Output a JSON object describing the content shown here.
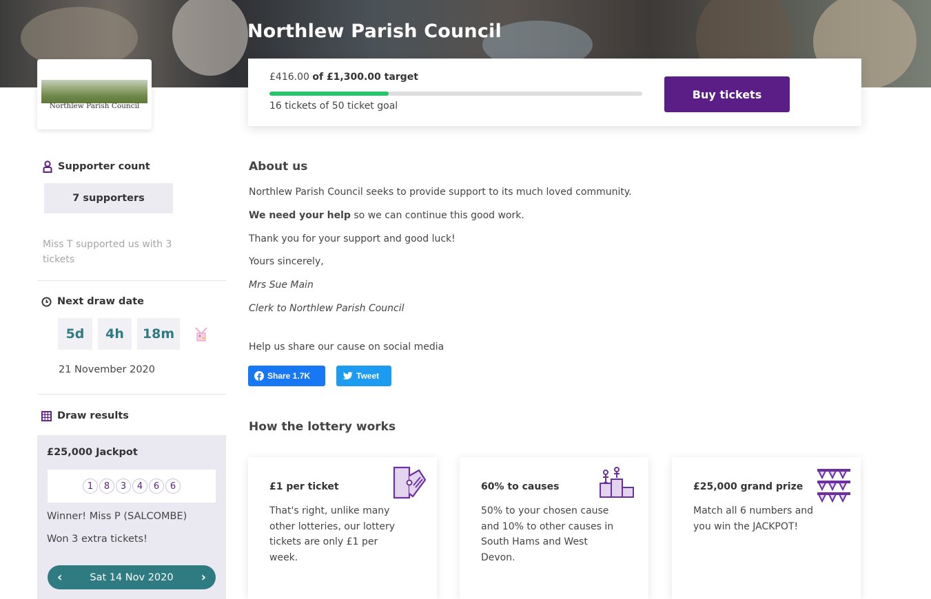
{
  "header": {
    "title": "Northlew Parish Council"
  },
  "logo": {
    "text": "Northlew Parish Council"
  },
  "progress": {
    "raised": "£416.00",
    "target_text": "of £1,300.00 target",
    "fraction_raised": 0.32,
    "tickets_text": "16 tickets of 50 ticket goal",
    "buy_label": "Buy tickets",
    "bar_color": "#22c76a",
    "button_color": "#5b1e86"
  },
  "sidebar": {
    "supporter_count_title": "Supporter count",
    "supporters": "7 supporters",
    "latest_support": "Miss T supported us with 3 tickets",
    "next_draw_title": "Next draw date",
    "countdown": {
      "days": "5d",
      "hours": "4h",
      "minutes": "18m"
    },
    "draw_date": "21 November 2020",
    "draw_results_title": "Draw results",
    "jackpot": "£25,000 Jackpot",
    "numbers": [
      "1",
      "8",
      "3",
      "4",
      "6",
      "6"
    ],
    "winner": "Winner! Miss P (SALCOMBE)",
    "won": "Won 3 extra tickets!",
    "result_date": "Sat 14 Nov 2020",
    "accent_color": "#2e7b82"
  },
  "about": {
    "title": "About us",
    "line1": "Northlew Parish Council seeks to provide support to its much loved community.",
    "line2_bold": "We need your help",
    "line2_rest": " so we can continue this good work.",
    "line3": "Thank you for your support and good luck!",
    "line4": "Yours sincerely,",
    "signature_name": "Mrs Sue Main",
    "signature_role": "Clerk to Northlew Parish Council",
    "share_prompt": "Help us share our cause on social media",
    "facebook_label": "Share 1.7K",
    "twitter_label": "Tweet"
  },
  "how": {
    "title": "How the lottery works",
    "cards": [
      {
        "title": "£1 per ticket",
        "body": "That's right, unlike many other lotteries, our lottery tickets are only £1 per week.",
        "icon": "ticket-icon"
      },
      {
        "title": "60% to causes",
        "body": "50% to your chosen cause and 10% to other causes in South Hams and West Devon.",
        "icon": "podium-icon"
      },
      {
        "title": "£25,000 grand prize",
        "body": "Match all 6 numbers and you win the JACKPOT!",
        "icon": "bunting-icon"
      }
    ]
  }
}
